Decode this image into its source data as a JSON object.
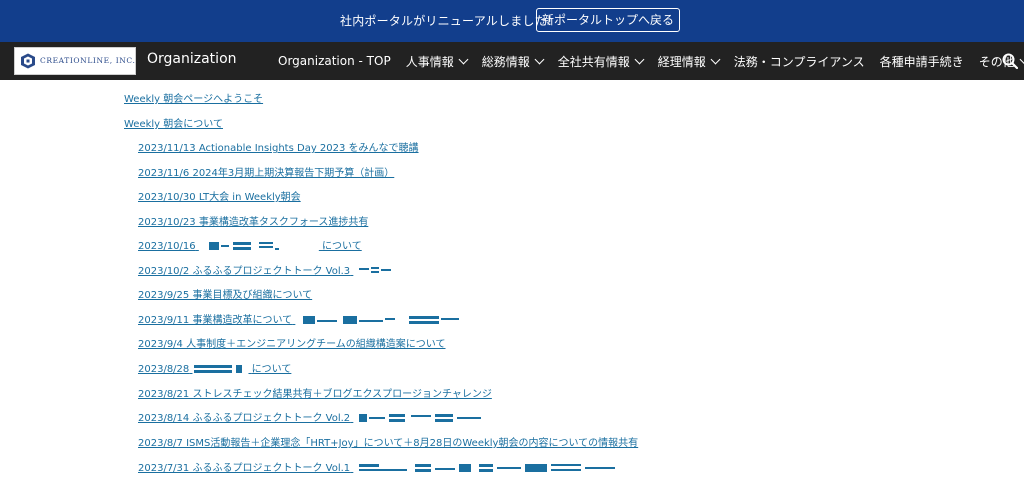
{
  "banner": {
    "message": "社内ポータルがリニューアルしました！",
    "button_label": "新ポータルトップへ戻る"
  },
  "header": {
    "logo_text": "CREATIONLINE, INC.",
    "site_name": "Organization",
    "nav": [
      {
        "label": "Organization - TOP",
        "dropdown": false
      },
      {
        "label": "人事情報",
        "dropdown": true
      },
      {
        "label": "総務情報",
        "dropdown": true
      },
      {
        "label": "全社共有情報",
        "dropdown": true
      },
      {
        "label": "経理情報",
        "dropdown": true
      },
      {
        "label": "法務・コンプライアンス",
        "dropdown": false
      },
      {
        "label": "各種申請手続き",
        "dropdown": false
      },
      {
        "label": "その他",
        "dropdown": true
      }
    ],
    "search_icon": "search-icon"
  },
  "links": {
    "top_level": [
      "Weekly 朝会ページへようこそ",
      "Weekly 朝会について"
    ],
    "meetings": [
      "2023/11/13 Actionable Insights Day 2023 をみんなで聴講",
      "2023/11/6 2024年3月期上期決算報告下期予算（計画）",
      "2023/10/30 LT大会 in Weekly朝会",
      "2023/10/23 事業構造改革タスクフォース進捗共有",
      "2023/10/16",
      "2023/10/2 ふるふるプロジェクトトーク Vol.3",
      "2023/9/25 事業目標及び組織について",
      "2023/9/11 事業構造改革について",
      "2023/9/4 人事制度＋エンジニアリングチームの組織構造案について",
      "2023/8/28",
      "2023/8/21 ストレスチェック結果共有＋ブログエクスプロージョンチャレンジ",
      "2023/8/14 ふるふるプロジェクトトーク Vol.2",
      "2023/8/7 ISMS活動報告＋企業理念「HRT+Joy」について＋8月28日のWeekly朝会の内容についての情報共有",
      "2023/7/31 ふるふるプロジェクトトーク Vol.1"
    ],
    "suffix_text": {
      "item_4": "について",
      "item_9": "について"
    }
  },
  "colors": {
    "banner_bg": "#123e8c",
    "nav_bg": "#222222",
    "link": "#1a6fa0"
  }
}
